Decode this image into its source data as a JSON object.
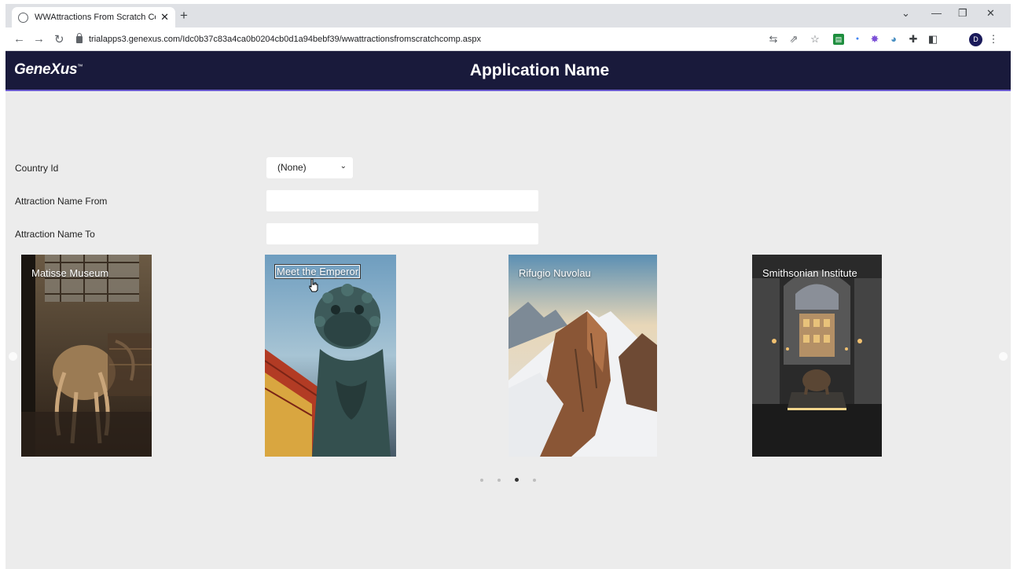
{
  "browser": {
    "tab_title": "WWAttractions From Scratch Cor",
    "new_tab": "+",
    "url": "trialapps3.genexus.com/Idc0b37c83a4ca0b0204cb0d1a94bebf39/wwattractionsfromscratchcomp.aspx",
    "profile_initial": "D"
  },
  "header": {
    "logo": "GeneXus",
    "app_name": "Application Name"
  },
  "filters": {
    "country_label": "Country Id",
    "country_value": "(None)",
    "name_from_label": "Attraction Name From",
    "name_from_value": "",
    "name_to_label": "Attraction Name To",
    "name_to_value": ""
  },
  "carousel": {
    "cards": [
      {
        "caption": "Matisse Museum"
      },
      {
        "caption": "Meet the Emperor"
      },
      {
        "caption": "Rifugio Nuvolau"
      },
      {
        "caption": "Smithsonian Institute"
      }
    ],
    "pages": 4,
    "active_page": 3
  }
}
